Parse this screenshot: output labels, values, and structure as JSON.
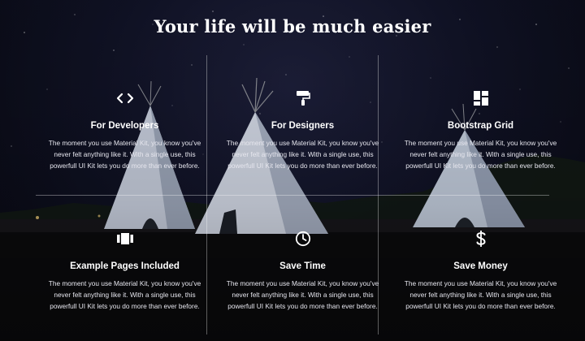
{
  "section": {
    "title": "Your life will be much easier"
  },
  "features": [
    {
      "icon": "code-icon",
      "title": "For Developers",
      "description": "The moment you use Material Kit, you know you've never felt anything like it. With a single use, this powerfull UI Kit lets you do more than ever before."
    },
    {
      "icon": "paint-roller-icon",
      "title": "For Designers",
      "description": "The moment you use Material Kit, you know you've never felt anything like it. With a single use, this powerfull UI Kit lets you do more than ever before."
    },
    {
      "icon": "grid-icon",
      "title": "Bootstrap Grid",
      "description": "The moment you use Material Kit, you know you've never felt anything like it. With a single use, this powerfull UI Kit lets you do more than ever before."
    },
    {
      "icon": "pages-icon",
      "title": "Example Pages Included",
      "description": "The moment you use Material Kit, you know you've never felt anything like it. With a single use, this powerfull UI Kit lets you do more than ever before."
    },
    {
      "icon": "clock-icon",
      "title": "Save Time",
      "description": "The moment you use Material Kit, you know you've never felt anything like it. With a single use, this powerfull UI Kit lets you do more than ever before."
    },
    {
      "icon": "dollar-icon",
      "title": "Save Money",
      "description": "The moment you use Material Kit, you know you've never felt anything like it. With a single use, this powerfull UI Kit lets you do more than ever before."
    }
  ]
}
